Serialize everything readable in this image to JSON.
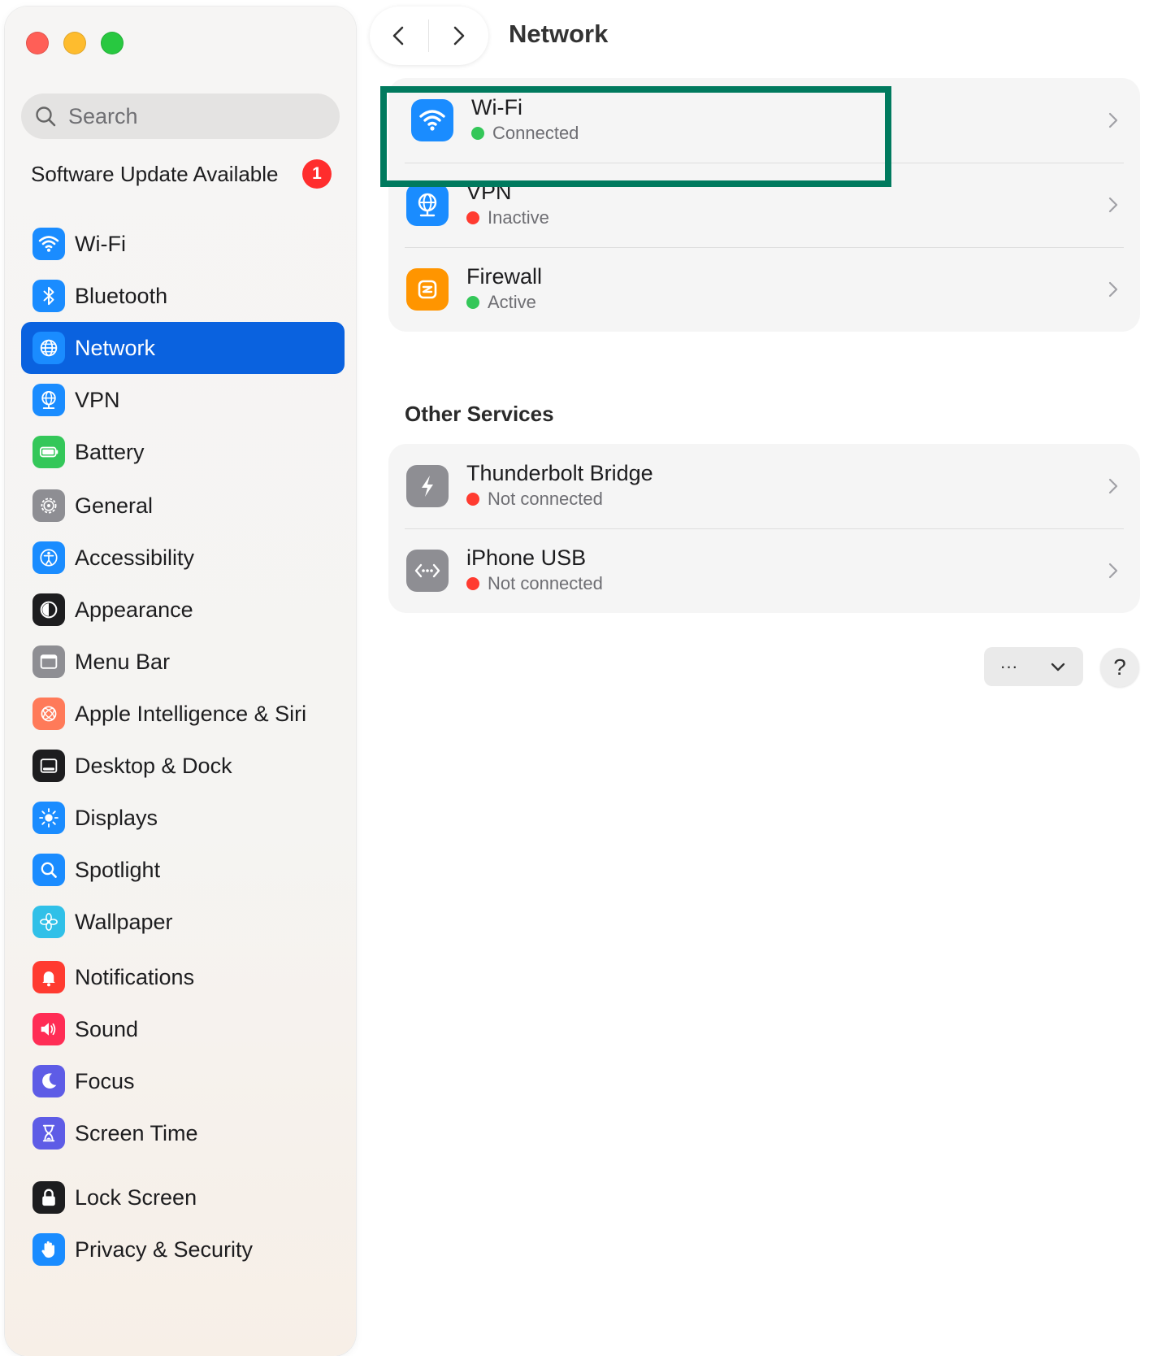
{
  "window": {
    "title": "Network"
  },
  "sidebar": {
    "search": {
      "placeholder": "Search",
      "value": ""
    },
    "update": {
      "label": "Software Update Available",
      "badge": "1"
    },
    "groups": [
      [
        {
          "label": "Wi-Fi",
          "icon": "wifi-icon",
          "color": "#1a8cff"
        },
        {
          "label": "Bluetooth",
          "icon": "bluetooth-icon",
          "color": "#1a8cff"
        },
        {
          "label": "Network",
          "icon": "globe-icon",
          "color": "#1a8cff",
          "active": true
        },
        {
          "label": "VPN",
          "icon": "vpn-globe-icon",
          "color": "#1a8cff"
        },
        {
          "label": "Battery",
          "icon": "battery-icon",
          "color": "#34c759"
        }
      ],
      [
        {
          "label": "General",
          "icon": "gear-icon",
          "color": "#8e8e93"
        },
        {
          "label": "Accessibility",
          "icon": "accessibility-icon",
          "color": "#1a8cff"
        },
        {
          "label": "Appearance",
          "icon": "appearance-icon",
          "color": "#1d1d1f"
        },
        {
          "label": "Menu Bar",
          "icon": "menu-bar-icon",
          "color": "#8e8e93"
        },
        {
          "label": "Apple Intelligence & Siri",
          "icon": "siri-icon",
          "color": "#ff7a59"
        },
        {
          "label": "Desktop & Dock",
          "icon": "dock-icon",
          "color": "#1d1d1f"
        },
        {
          "label": "Displays",
          "icon": "sun-icon",
          "color": "#1a8cff"
        },
        {
          "label": "Spotlight",
          "icon": "spotlight-icon",
          "color": "#1a8cff"
        },
        {
          "label": "Wallpaper",
          "icon": "flower-icon",
          "color": "#30c0e8"
        }
      ],
      [
        {
          "label": "Notifications",
          "icon": "bell-icon",
          "color": "#ff3b30"
        },
        {
          "label": "Sound",
          "icon": "speaker-icon",
          "color": "#ff2d55"
        },
        {
          "label": "Focus",
          "icon": "moon-icon",
          "color": "#5e5ce6"
        },
        {
          "label": "Screen Time",
          "icon": "hourglass-icon",
          "color": "#5e5ce6"
        }
      ],
      [
        {
          "label": "Lock Screen",
          "icon": "lock-icon",
          "color": "#1d1d1f"
        },
        {
          "label": "Privacy & Security",
          "icon": "hand-icon",
          "color": "#1a8cff"
        }
      ]
    ]
  },
  "main": {
    "primary_services": [
      {
        "name": "Wi-Fi",
        "status": "Connected",
        "status_color": "#34c759",
        "icon": "wifi-icon",
        "icon_color": "#1a8cff"
      },
      {
        "name": "VPN",
        "status": "Inactive",
        "status_color": "#ff3b30",
        "icon": "vpn-globe-icon",
        "icon_color": "#1a8cff"
      },
      {
        "name": "Firewall",
        "status": "Active",
        "status_color": "#34c759",
        "icon": "firewall-icon",
        "icon_color": "#ff9500"
      }
    ],
    "other_services_title": "Other Services",
    "other_services": [
      {
        "name": "Thunderbolt Bridge",
        "status": "Not connected",
        "status_color": "#ff3b30",
        "icon": "thunderbolt-icon",
        "icon_color": "#8e8e93"
      },
      {
        "name": "iPhone USB",
        "status": "Not connected",
        "status_color": "#ff3b30",
        "icon": "usb-icon",
        "icon_color": "#8e8e93"
      }
    ],
    "actions": {
      "more_label": "···"
    },
    "help_label": "?"
  }
}
